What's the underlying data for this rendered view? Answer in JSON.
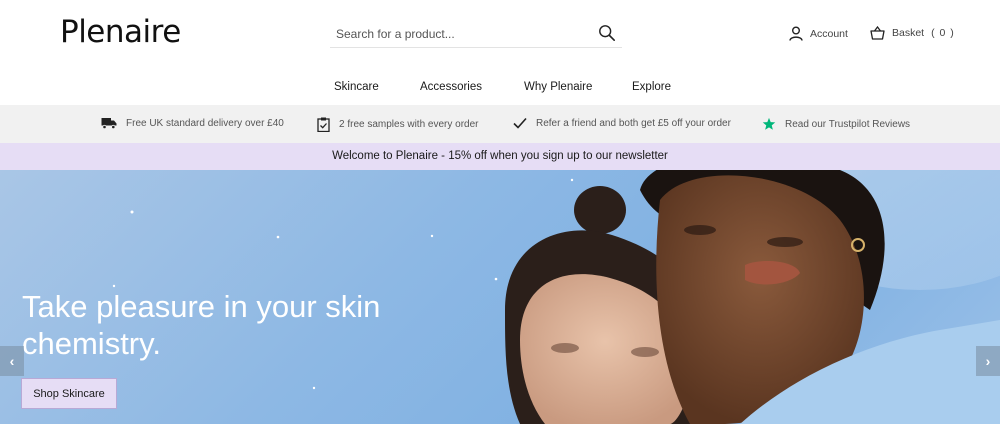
{
  "header": {
    "logo": "Plenaire",
    "search_placeholder": "Search for a product...",
    "account_label": "Account",
    "basket_label": "Basket",
    "basket_count": "( 0 )"
  },
  "nav": {
    "items": [
      "Skincare",
      "Accessories",
      "Why Plenaire",
      "Explore"
    ]
  },
  "usp": {
    "items": [
      {
        "icon": "truck-icon",
        "text": "Free UK standard delivery over £40"
      },
      {
        "icon": "clipboard-icon",
        "text": "2 free samples with every order"
      },
      {
        "icon": "checkmark-icon",
        "text": "Refer a friend and both get £5 off your order"
      },
      {
        "icon": "star-icon",
        "text": "Read our Trustpilot Reviews"
      }
    ]
  },
  "promo": {
    "text": "Welcome to Plenaire - 15% off when you sign up to our newsletter",
    "background": "#e6ddf5"
  },
  "hero": {
    "heading": "Take pleasure in your skin chemistry.",
    "cta_label": "Shop Skincare",
    "prev_label": "‹",
    "next_label": "›"
  },
  "colors": {
    "accent": "#e6ddf5",
    "trustpilot_star": "#00b67a",
    "hero_sky": "#8db8e4"
  }
}
